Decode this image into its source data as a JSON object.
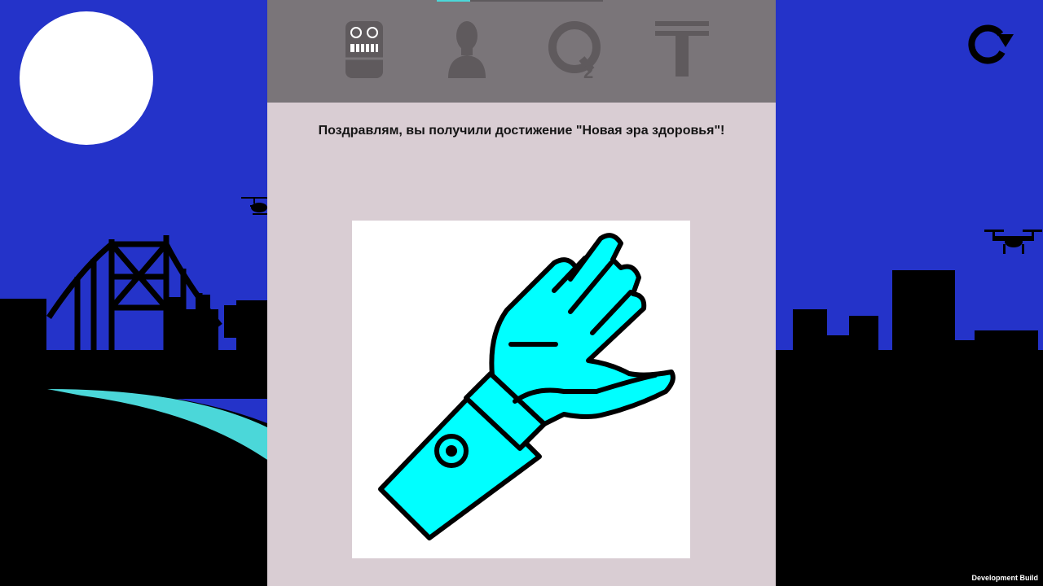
{
  "nav": {
    "tabs": [
      {
        "name": "robot",
        "icon": "robot-icon"
      },
      {
        "name": "person",
        "icon": "person-icon"
      },
      {
        "name": "o2",
        "icon": "o2-icon",
        "label": "2"
      },
      {
        "name": "t",
        "icon": "t-letter-icon"
      }
    ],
    "progress": 0.2
  },
  "message": "Поздравлям, вы получили достижение \"Новая эра здоровья\"!",
  "achievement": {
    "icon": "bionic-hand-icon"
  },
  "refresh": {
    "icon": "refresh-icon"
  },
  "footer": {
    "dev_build": "Development Build"
  },
  "colors": {
    "sky": "#2433c9",
    "panel": "#d9cdd3",
    "top_bar": "#7a7579",
    "icon": "#5f5a5d",
    "accent": "#00ffff",
    "river": "#4bd7d9"
  }
}
